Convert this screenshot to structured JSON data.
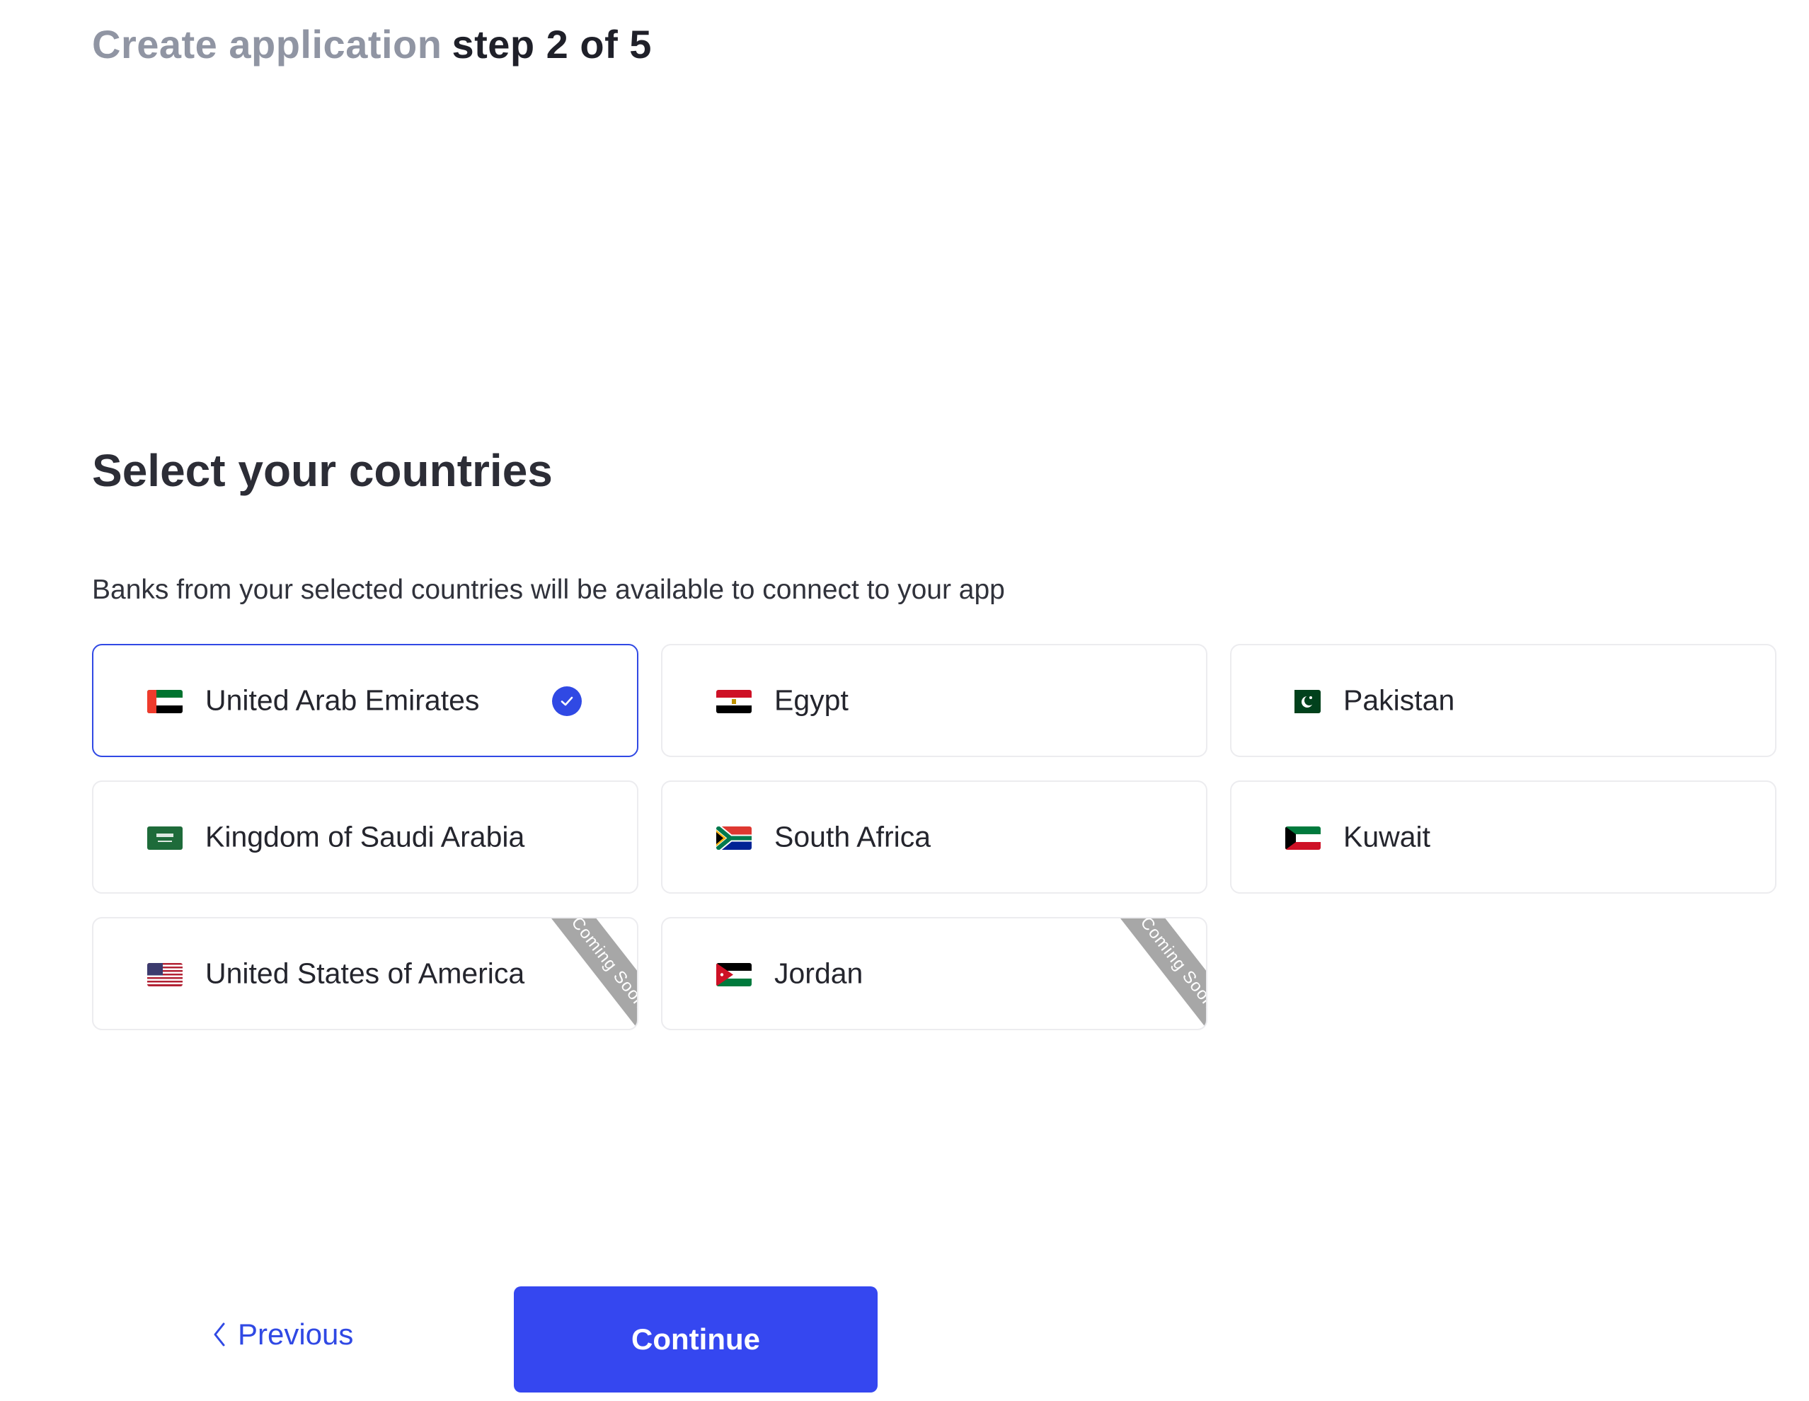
{
  "header": {
    "title": "Create application",
    "step": "step 2 of 5"
  },
  "section": {
    "title": "Select your countries",
    "subtitle": "Banks from your selected countries will be available to connect to your app"
  },
  "countries": [
    {
      "name": "United Arab Emirates",
      "flag": "uae-flag-icon",
      "selected": true,
      "badge": ""
    },
    {
      "name": "Egypt",
      "flag": "egypt-flag-icon",
      "selected": false,
      "badge": ""
    },
    {
      "name": "Pakistan",
      "flag": "pakistan-flag-icon",
      "selected": false,
      "badge": ""
    },
    {
      "name": "Kingdom of Saudi Arabia",
      "flag": "saudi-arabia-flag-icon",
      "selected": false,
      "badge": ""
    },
    {
      "name": "South Africa",
      "flag": "south-africa-flag-icon",
      "selected": false,
      "badge": ""
    },
    {
      "name": "Kuwait",
      "flag": "kuwait-flag-icon",
      "selected": false,
      "badge": ""
    },
    {
      "name": "United States of America",
      "flag": "usa-flag-icon",
      "selected": false,
      "badge": "Coming Soon"
    },
    {
      "name": "Jordan",
      "flag": "jordan-flag-icon",
      "selected": false,
      "badge": "Coming Soon"
    }
  ],
  "footer": {
    "previous_label": "Previous",
    "continue_label": "Continue"
  },
  "colors": {
    "accent": "#3547f0",
    "selected_border": "#3049e4",
    "ribbon": "#a7a7a7",
    "muted_title": "#9095a3"
  }
}
